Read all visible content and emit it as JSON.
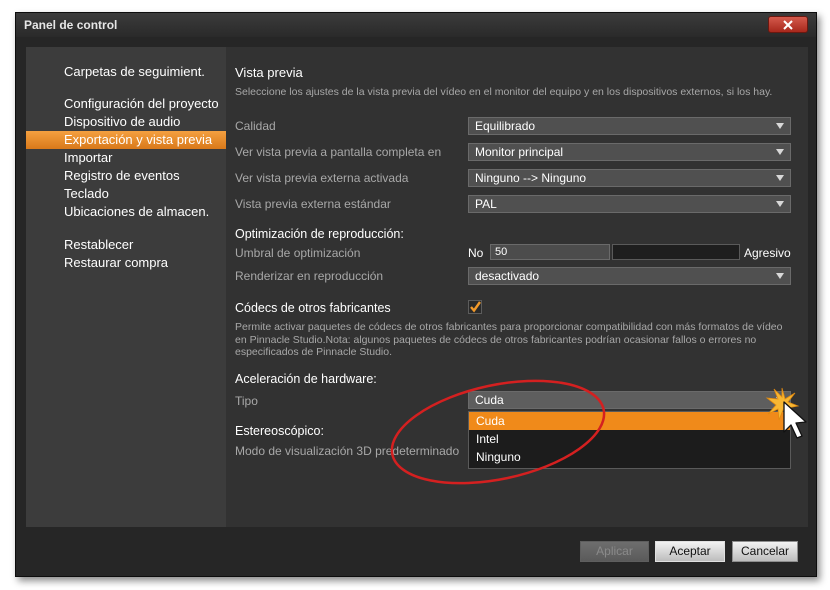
{
  "window": {
    "title": "Panel de control"
  },
  "sidebar": {
    "items": [
      {
        "label": "Carpetas de seguimient.",
        "active": false
      },
      {
        "label": "Configuración del proyecto",
        "active": false
      },
      {
        "label": "Dispositivo de audio",
        "active": false
      },
      {
        "label": "Exportación y vista previa",
        "active": true
      },
      {
        "label": "Importar",
        "active": false
      },
      {
        "label": "Registro de eventos",
        "active": false
      },
      {
        "label": "Teclado",
        "active": false
      },
      {
        "label": "Ubicaciones de almacen.",
        "active": false
      },
      {
        "label": "Restablecer",
        "active": false
      },
      {
        "label": "Restaurar compra",
        "active": false
      }
    ]
  },
  "preview": {
    "heading": "Vista previa",
    "description": "Seleccione los ajustes de la vista previa del vídeo en el monitor del equipo y en los dispositivos externos, si los hay.",
    "quality_label": "Calidad",
    "quality_value": "Equilibrado",
    "fullscreen_label": "Ver vista previa a pantalla completa en",
    "fullscreen_value": "Monitor principal",
    "external_label": "Ver vista previa externa activada",
    "external_value": "Ninguno --> Ninguno",
    "standard_label": "Vista previa externa estándar",
    "standard_value": "PAL"
  },
  "optimization": {
    "heading": "Optimización de reproducción:",
    "threshold_label": "Umbral de optimización",
    "min_label": "No",
    "value": "50",
    "max_label": "Agresivo",
    "render_label": "Renderizar en reproducción",
    "render_value": "desactivado"
  },
  "codecs": {
    "heading": "Códecs de otros fabricantes",
    "checked": true,
    "description": "Permite activar paquetes de códecs de otros fabricantes para proporcionar compatibilidad con más formatos de vídeo en Pinnacle Studio.Nota: algunos paquetes de códecs de otros fabricantes podrían ocasionar fallos o errores no especificados de Pinnacle Studio."
  },
  "hardware": {
    "heading": "Aceleración de hardware:",
    "type_label": "Tipo",
    "type_value": "Cuda",
    "options": [
      "Cuda",
      "Intel",
      "Ninguno"
    ]
  },
  "stereo": {
    "heading": "Estereoscópico:",
    "mode_label": "Modo de visualización 3D predeterminado"
  },
  "footer": {
    "apply": "Aplicar",
    "accept": "Aceptar",
    "cancel": "Cancelar"
  },
  "colors": {
    "accent": "#f08a1a",
    "annotation": "#d42020",
    "close": "#c0392b"
  }
}
